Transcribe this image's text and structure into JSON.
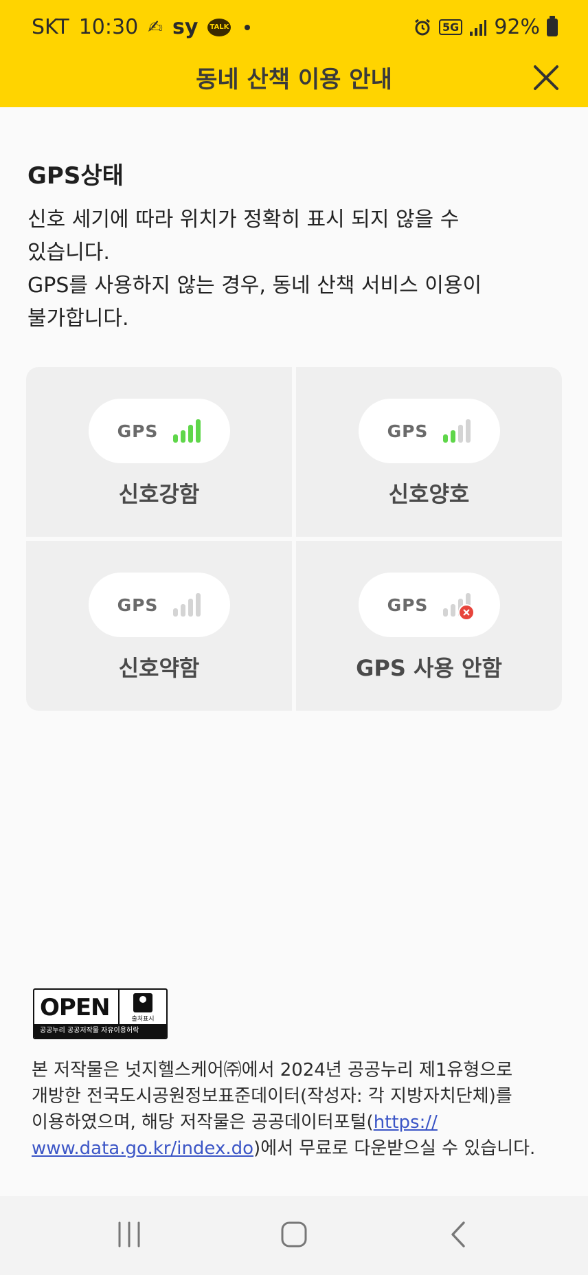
{
  "status_bar": {
    "carrier": "SKT",
    "time": "10:30",
    "app_text": "sy",
    "kakao_label": "TALK",
    "network": "5G",
    "battery_percent": "92%"
  },
  "header": {
    "title": "동네 산책 이용 안내"
  },
  "gps_section": {
    "title": "GPS상태",
    "desc_lines": [
      "신호 세기에 따라 위치가 정확히 표시 되지 않을 수",
      "있습니다.",
      "GPS를 사용하지 않는 경우, 동네 산책 서비스 이용이",
      "불가합니다."
    ],
    "states": [
      {
        "badge": "GPS",
        "label": "신호강함",
        "active_bars": 4
      },
      {
        "badge": "GPS",
        "label": "신호양호",
        "active_bars": 2
      },
      {
        "badge": "GPS",
        "label": "신호약함",
        "active_bars": 0
      },
      {
        "badge": "GPS",
        "label": "GPS 사용 안함",
        "active_bars": 0,
        "disabled": true
      }
    ]
  },
  "license": {
    "badge_main": "OPEN",
    "badge_side": "출처표시",
    "badge_footer": "공공누리  공공저작물 자유이용허락",
    "lines": [
      "본 저작물은 넛지헬스케어㈜에서 2024년 공공누리 제1유형으로",
      "개방한 전국도시공원정보표준데이터(작성자: 각 지방자치단체)를",
      "이용하였으며, 해당 저작물은 공공데이터포털("
    ],
    "link_part1": "https://",
    "link_part2": "www.data.go.kr/index.do",
    "line4_suffix": ")에서 무료로 다운받으실 수 있습니다."
  },
  "colors": {
    "header_bg": "#FFD400",
    "signal_on": "#5fd64a",
    "signal_off": "#d4d4d4",
    "error": "#e7443b",
    "link": "#3b55c6"
  }
}
